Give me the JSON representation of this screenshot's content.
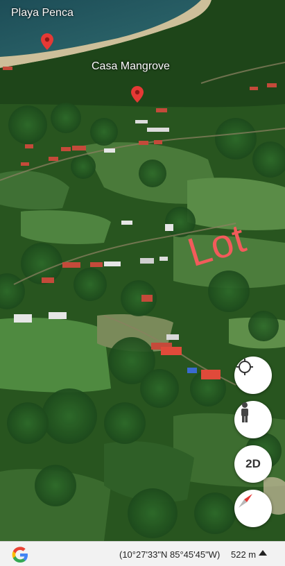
{
  "map": {
    "places": [
      {
        "name": "Playa Penca"
      },
      {
        "name": "Casa Mangrove"
      }
    ],
    "overlay_text": "Lot",
    "overlay_color": "#f25b5b",
    "pin_color": "#e53935"
  },
  "controls": {
    "locate_icon": "crosshair-icon",
    "street_view_icon": "pegman-icon",
    "view_mode_label": "2D",
    "compass_icon": "compass-icon"
  },
  "status_bar": {
    "logo": "google-g-logo",
    "coordinates": "(10°27'33\"N 85°45'45\"W)",
    "scale": "522 m",
    "expand_icon": "caret-up-icon"
  }
}
